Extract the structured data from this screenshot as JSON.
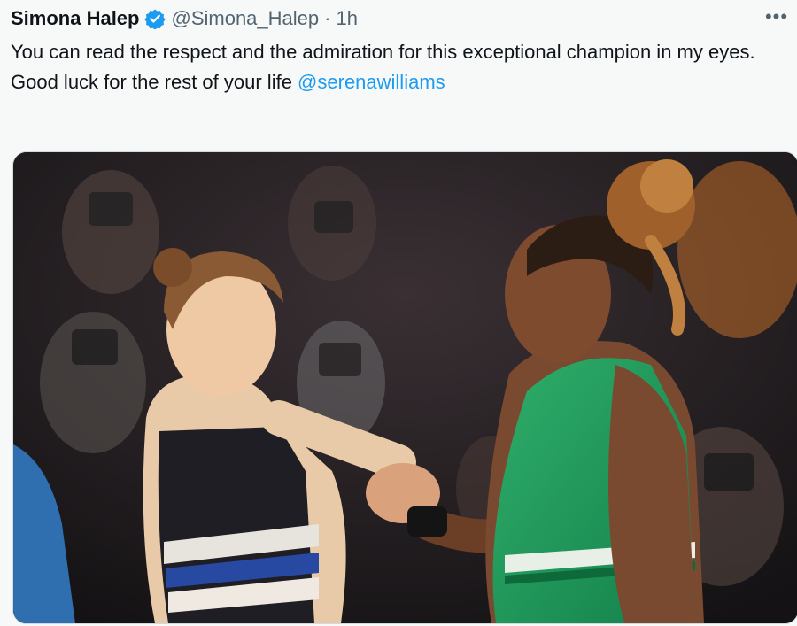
{
  "tweet": {
    "author": {
      "display_name": "Simona Halep",
      "handle": "@Simona_Halep",
      "verified_icon": "verified-badge-icon"
    },
    "separator": "·",
    "time": "1h",
    "more_icon": "more-options-icon",
    "more_label": "•••",
    "text": {
      "line1": "You can read the respect and the admiration for this exceptional champion in my eyes.",
      "line2_prefix": "Good luck for the rest of your life ",
      "mention": "@serenawilliams"
    },
    "media": {
      "kind": "photo"
    }
  },
  "colors": {
    "background": "#f7f9f9",
    "text": "#0f1419",
    "secondary": "#536471",
    "link": "#1d9bf0",
    "verified": "#1d9bf0"
  }
}
